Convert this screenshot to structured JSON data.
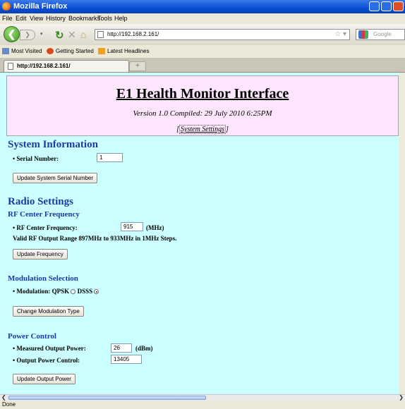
{
  "window": {
    "title": "Mozilla Firefox"
  },
  "menu": [
    "File",
    "Edit",
    "View",
    "History",
    "Bookmarks",
    "Tools",
    "Help"
  ],
  "nav": {
    "url": "http://192.168.2.161/",
    "search_placeholder": "Google"
  },
  "bookmarks": [
    "Most Visited",
    "Getting Started",
    "Latest Headlines"
  ],
  "tab": {
    "label": "http://192.168.2.161/",
    "new_tab": "+"
  },
  "page": {
    "title": "E1 Health Monitor Interface",
    "version": "Version 1.0 Compiled: 29 July 2010 6:25PM",
    "settings_prefix": "[",
    "settings_link": "System Settings",
    "settings_suffix": "]",
    "system_info": {
      "heading": "System Information",
      "serial_label": "• Serial Number:",
      "serial_value": "1",
      "button": "Update System Serial Number"
    },
    "radio": {
      "heading": "Radio Settings",
      "rf_heading": "RF Center Frequency",
      "rf_label": "• RF Center Frequency:",
      "rf_value": "915",
      "rf_unit": "(MHz)",
      "rf_range": "Valid RF Output Range 897MHz to 933MHz in 1MHz Steps.",
      "rf_button": "Update Frequency",
      "mod_heading": "Modulation Selection",
      "mod_label": "• Modulation: QPSK",
      "mod_option2": "DSSS",
      "mod_selected": "DSSS",
      "mod_button": "Change Modulation Type",
      "power_heading": "Power Control",
      "measured_label": "• Measured Output Power:",
      "measured_value": "26",
      "measured_unit": "(dBm)",
      "control_label": "• Output Power Control:",
      "control_value": "13405",
      "power_button": "Update Output Power"
    }
  },
  "status": {
    "text": "Done"
  },
  "colors": {
    "header_bg": "#ffe6ff",
    "page_bg": "#ccffff",
    "heading": "#1a3aa6"
  }
}
